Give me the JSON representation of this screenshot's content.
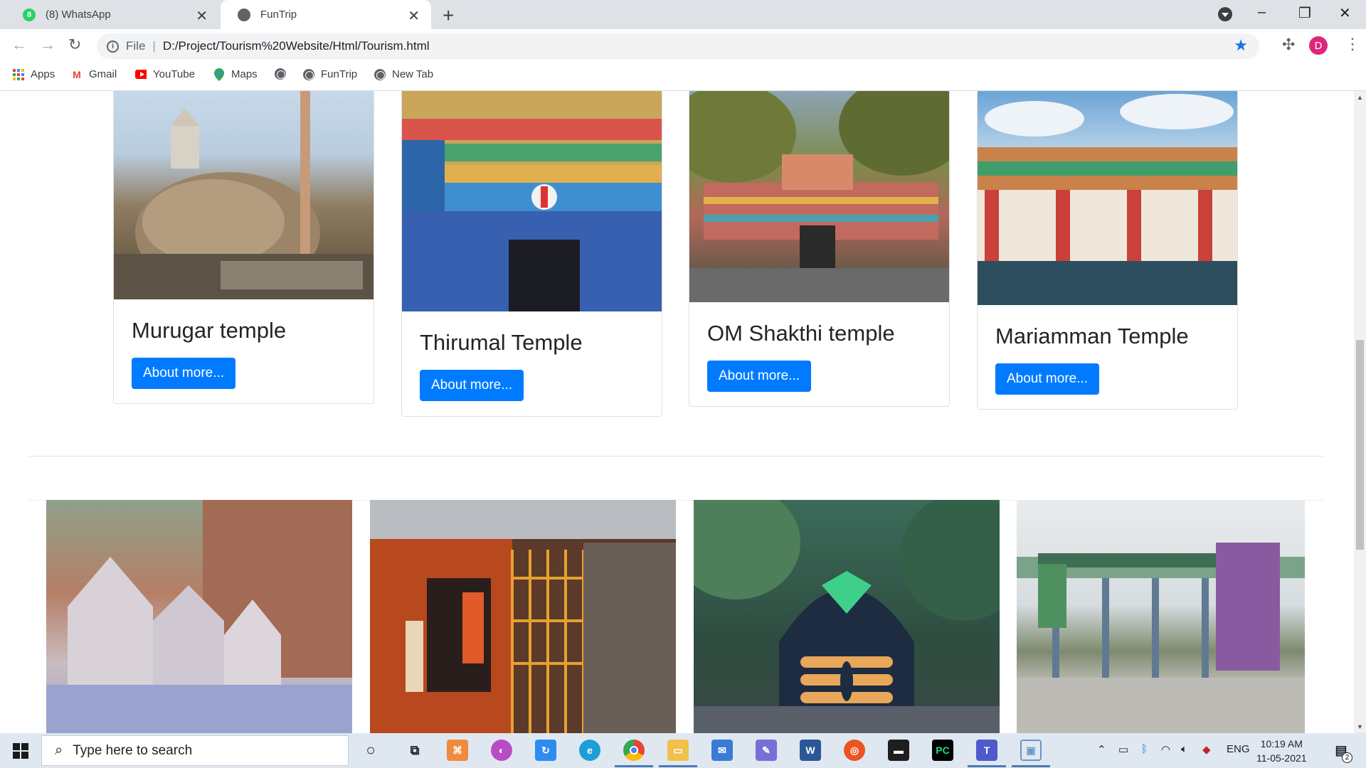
{
  "browser": {
    "tabs": [
      {
        "title": "(8) WhatsApp",
        "icon": "whatsapp-icon",
        "badge": "8",
        "active": false
      },
      {
        "title": "FunTrip",
        "icon": "globe-icon",
        "active": true
      }
    ],
    "address": {
      "scheme_label": "File",
      "url": "D:/Project/Tourism%20Website/Html/Tourism.html"
    },
    "profile_initial": "D",
    "bookmarks": [
      {
        "label": "Apps",
        "icon": "apps-grid-icon"
      },
      {
        "label": "Gmail",
        "icon": "gmail-icon"
      },
      {
        "label": "YouTube",
        "icon": "youtube-icon"
      },
      {
        "label": "Maps",
        "icon": "maps-pin-icon"
      },
      {
        "label": "",
        "icon": "globe-icon"
      },
      {
        "label": "FunTrip",
        "icon": "globe-icon"
      },
      {
        "label": "New Tab",
        "icon": "globe-icon"
      }
    ]
  },
  "page": {
    "cards": [
      {
        "title": "Murugar temple",
        "button": "About more..."
      },
      {
        "title": "Thirumal Temple",
        "button": "About more..."
      },
      {
        "title": "OM Shakthi temple",
        "button": "About more..."
      },
      {
        "title": "Mariamman Temple",
        "button": "About more..."
      }
    ]
  },
  "taskbar": {
    "search_placeholder": "Type here to search",
    "language": "ENG",
    "time": "10:19 AM",
    "date": "11-05-2021",
    "notification_count": "2"
  },
  "colors": {
    "primary_button": "#007bff",
    "tabbar": "#dee1e6",
    "taskbar": "#dfe8f1"
  }
}
